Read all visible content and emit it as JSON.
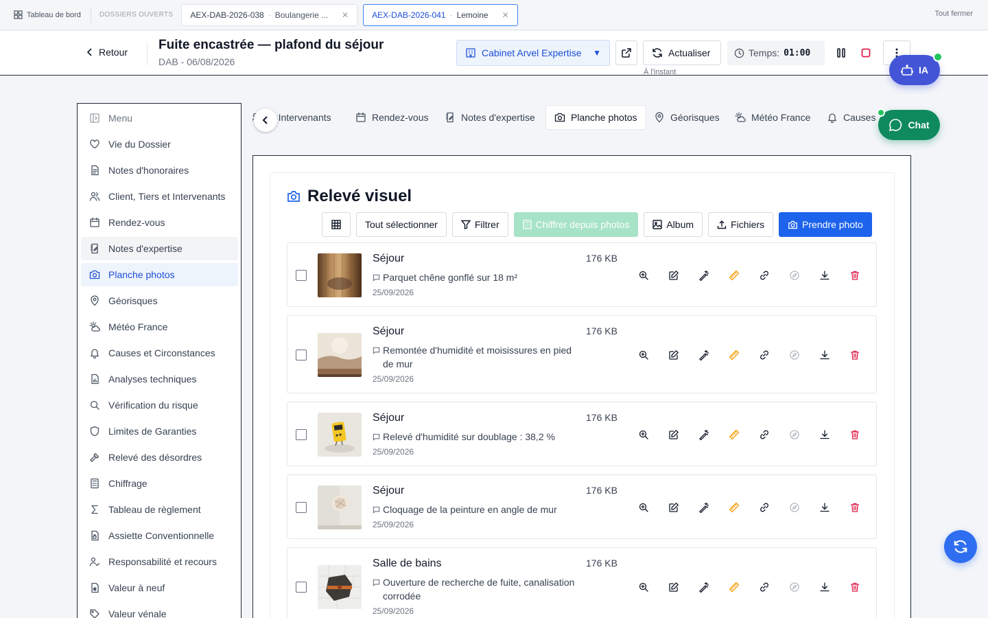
{
  "topbar": {
    "dashboard_label": "Tableau de bord",
    "opened_label": "DOSSIERS OUVERTS",
    "tabs": [
      {
        "ref": "AEX-DAB-2026-038",
        "name": "Boulangerie ..."
      },
      {
        "ref": "AEX-DAB-2026-041",
        "name": "Lemoine"
      }
    ],
    "close_all": "Tout fermer"
  },
  "header": {
    "back": "Retour",
    "title": "Fuite encastrée — plafond du séjour",
    "subtitle": "DAB - 06/08/2026",
    "cabinet": "Cabinet Arvel Expertise",
    "refresh": "Actualiser",
    "refresh_note": "À l'instant",
    "time_label": "Temps:",
    "time_value": "01:00"
  },
  "floating": {
    "ia": "IA",
    "chat": "Chat"
  },
  "sidebar": {
    "items": [
      {
        "label": "Menu",
        "icon": "sidebar-toggle-icon"
      },
      {
        "label": "Vie du Dossier",
        "icon": "heart-icon"
      },
      {
        "label": "Notes d'honoraires",
        "icon": "document-icon"
      },
      {
        "label": "Client, Tiers et Intervenants",
        "icon": "users-icon"
      },
      {
        "label": "Rendez-vous",
        "icon": "calendar-icon"
      },
      {
        "label": "Notes d'expertise",
        "icon": "notebook-icon"
      },
      {
        "label": "Planche photos",
        "icon": "camera-icon"
      },
      {
        "label": "Géorisques",
        "icon": "map-pin-icon"
      },
      {
        "label": "Météo France",
        "icon": "weather-icon"
      },
      {
        "label": "Causes et Circonstances",
        "icon": "bell-icon"
      },
      {
        "label": "Analyses techniques",
        "icon": "report-icon"
      },
      {
        "label": "Vérification du risque",
        "icon": "search-icon"
      },
      {
        "label": "Limites de Garanties",
        "icon": "shield-icon"
      },
      {
        "label": "Relevé des désordres",
        "icon": "hammer-icon"
      },
      {
        "label": "Chiffrage",
        "icon": "calculator-icon"
      },
      {
        "label": "Tableau de règlement",
        "icon": "sigma-icon"
      },
      {
        "label": "Assiette Conventionnelle",
        "icon": "file-lock-icon"
      },
      {
        "label": "Responsabilité et recours",
        "icon": "user-check-icon"
      },
      {
        "label": "Valeur à neuf",
        "icon": "file-euro-icon"
      },
      {
        "label": "Valeur vénale",
        "icon": "tag-icon"
      }
    ]
  },
  "section_tabs": [
    {
      "label": "et Intervenants",
      "icon": "users-icon"
    },
    {
      "label": "Rendez-vous",
      "icon": "calendar-icon"
    },
    {
      "label": "Notes d'expertise",
      "icon": "notebook-icon"
    },
    {
      "label": "Planche photos",
      "icon": "camera-icon"
    },
    {
      "label": "Géorisques",
      "icon": "map-pin-icon"
    },
    {
      "label": "Météo France",
      "icon": "weather-icon"
    },
    {
      "label": "Causes",
      "icon": "bell-icon"
    }
  ],
  "main": {
    "title": "Relevé visuel",
    "toolbar": {
      "select_all": "Tout sélectionner",
      "filter": "Filtrer",
      "chiffrer": "Chiffrer depuis photos",
      "album": "Album",
      "files": "Fichiers",
      "take_photo": "Prendre photo"
    },
    "photos": [
      {
        "room": "Séjour",
        "desc": "Parquet chêne gonflé sur 18 m²",
        "date": "25/09/2026",
        "size": "176 KB",
        "thumb": "parquet"
      },
      {
        "room": "Séjour",
        "desc": "Remontée d'humidité et moisissures en pied de mur",
        "date": "25/09/2026",
        "size": "176 KB",
        "thumb": "wall"
      },
      {
        "room": "Séjour",
        "desc": "Relevé d'humidité sur doublage : 38,2 %",
        "date": "25/09/2026",
        "size": "176 KB",
        "thumb": "meter"
      },
      {
        "room": "Séjour",
        "desc": "Cloquage de la peinture en angle de mur",
        "date": "25/09/2026",
        "size": "176 KB",
        "thumb": "paint"
      },
      {
        "room": "Salle de bains",
        "desc": "Ouverture de recherche de fuite, canalisation corrodée",
        "date": "25/09/2026",
        "size": "176 KB",
        "thumb": "pipe"
      }
    ]
  },
  "colors": {
    "accent": "#1d63ec",
    "ia": "#4355d6",
    "chat": "#0f8a5f",
    "delete": "#e11d48",
    "measure": "#f59e0b"
  }
}
